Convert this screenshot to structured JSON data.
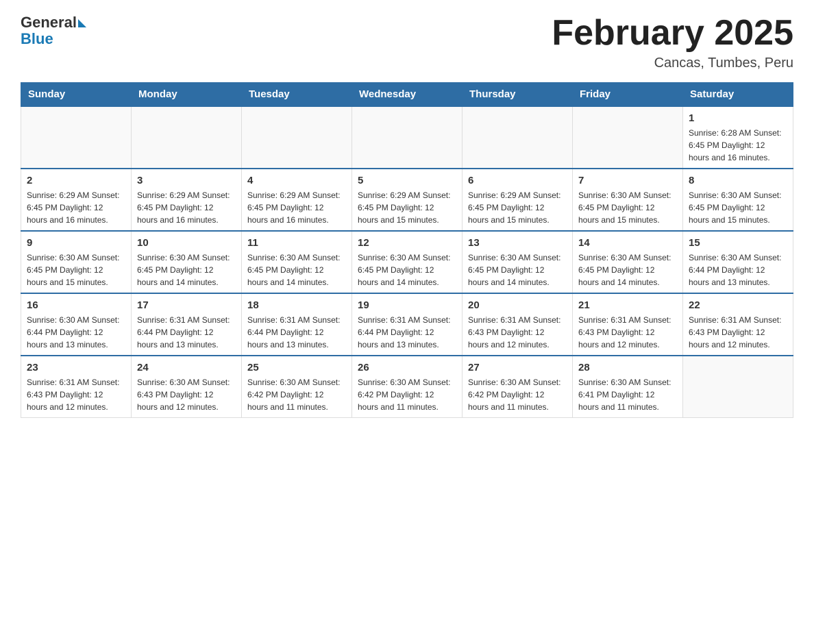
{
  "header": {
    "logo_text": "General",
    "logo_blue": "Blue",
    "month_title": "February 2025",
    "location": "Cancas, Tumbes, Peru"
  },
  "days_of_week": [
    "Sunday",
    "Monday",
    "Tuesday",
    "Wednesday",
    "Thursday",
    "Friday",
    "Saturday"
  ],
  "weeks": [
    [
      {
        "day": "",
        "info": ""
      },
      {
        "day": "",
        "info": ""
      },
      {
        "day": "",
        "info": ""
      },
      {
        "day": "",
        "info": ""
      },
      {
        "day": "",
        "info": ""
      },
      {
        "day": "",
        "info": ""
      },
      {
        "day": "1",
        "info": "Sunrise: 6:28 AM\nSunset: 6:45 PM\nDaylight: 12 hours and 16 minutes."
      }
    ],
    [
      {
        "day": "2",
        "info": "Sunrise: 6:29 AM\nSunset: 6:45 PM\nDaylight: 12 hours and 16 minutes."
      },
      {
        "day": "3",
        "info": "Sunrise: 6:29 AM\nSunset: 6:45 PM\nDaylight: 12 hours and 16 minutes."
      },
      {
        "day": "4",
        "info": "Sunrise: 6:29 AM\nSunset: 6:45 PM\nDaylight: 12 hours and 16 minutes."
      },
      {
        "day": "5",
        "info": "Sunrise: 6:29 AM\nSunset: 6:45 PM\nDaylight: 12 hours and 15 minutes."
      },
      {
        "day": "6",
        "info": "Sunrise: 6:29 AM\nSunset: 6:45 PM\nDaylight: 12 hours and 15 minutes."
      },
      {
        "day": "7",
        "info": "Sunrise: 6:30 AM\nSunset: 6:45 PM\nDaylight: 12 hours and 15 minutes."
      },
      {
        "day": "8",
        "info": "Sunrise: 6:30 AM\nSunset: 6:45 PM\nDaylight: 12 hours and 15 minutes."
      }
    ],
    [
      {
        "day": "9",
        "info": "Sunrise: 6:30 AM\nSunset: 6:45 PM\nDaylight: 12 hours and 15 minutes."
      },
      {
        "day": "10",
        "info": "Sunrise: 6:30 AM\nSunset: 6:45 PM\nDaylight: 12 hours and 14 minutes."
      },
      {
        "day": "11",
        "info": "Sunrise: 6:30 AM\nSunset: 6:45 PM\nDaylight: 12 hours and 14 minutes."
      },
      {
        "day": "12",
        "info": "Sunrise: 6:30 AM\nSunset: 6:45 PM\nDaylight: 12 hours and 14 minutes."
      },
      {
        "day": "13",
        "info": "Sunrise: 6:30 AM\nSunset: 6:45 PM\nDaylight: 12 hours and 14 minutes."
      },
      {
        "day": "14",
        "info": "Sunrise: 6:30 AM\nSunset: 6:45 PM\nDaylight: 12 hours and 14 minutes."
      },
      {
        "day": "15",
        "info": "Sunrise: 6:30 AM\nSunset: 6:44 PM\nDaylight: 12 hours and 13 minutes."
      }
    ],
    [
      {
        "day": "16",
        "info": "Sunrise: 6:30 AM\nSunset: 6:44 PM\nDaylight: 12 hours and 13 minutes."
      },
      {
        "day": "17",
        "info": "Sunrise: 6:31 AM\nSunset: 6:44 PM\nDaylight: 12 hours and 13 minutes."
      },
      {
        "day": "18",
        "info": "Sunrise: 6:31 AM\nSunset: 6:44 PM\nDaylight: 12 hours and 13 minutes."
      },
      {
        "day": "19",
        "info": "Sunrise: 6:31 AM\nSunset: 6:44 PM\nDaylight: 12 hours and 13 minutes."
      },
      {
        "day": "20",
        "info": "Sunrise: 6:31 AM\nSunset: 6:43 PM\nDaylight: 12 hours and 12 minutes."
      },
      {
        "day": "21",
        "info": "Sunrise: 6:31 AM\nSunset: 6:43 PM\nDaylight: 12 hours and 12 minutes."
      },
      {
        "day": "22",
        "info": "Sunrise: 6:31 AM\nSunset: 6:43 PM\nDaylight: 12 hours and 12 minutes."
      }
    ],
    [
      {
        "day": "23",
        "info": "Sunrise: 6:31 AM\nSunset: 6:43 PM\nDaylight: 12 hours and 12 minutes."
      },
      {
        "day": "24",
        "info": "Sunrise: 6:30 AM\nSunset: 6:43 PM\nDaylight: 12 hours and 12 minutes."
      },
      {
        "day": "25",
        "info": "Sunrise: 6:30 AM\nSunset: 6:42 PM\nDaylight: 12 hours and 11 minutes."
      },
      {
        "day": "26",
        "info": "Sunrise: 6:30 AM\nSunset: 6:42 PM\nDaylight: 12 hours and 11 minutes."
      },
      {
        "day": "27",
        "info": "Sunrise: 6:30 AM\nSunset: 6:42 PM\nDaylight: 12 hours and 11 minutes."
      },
      {
        "day": "28",
        "info": "Sunrise: 6:30 AM\nSunset: 6:41 PM\nDaylight: 12 hours and 11 minutes."
      },
      {
        "day": "",
        "info": ""
      }
    ]
  ]
}
